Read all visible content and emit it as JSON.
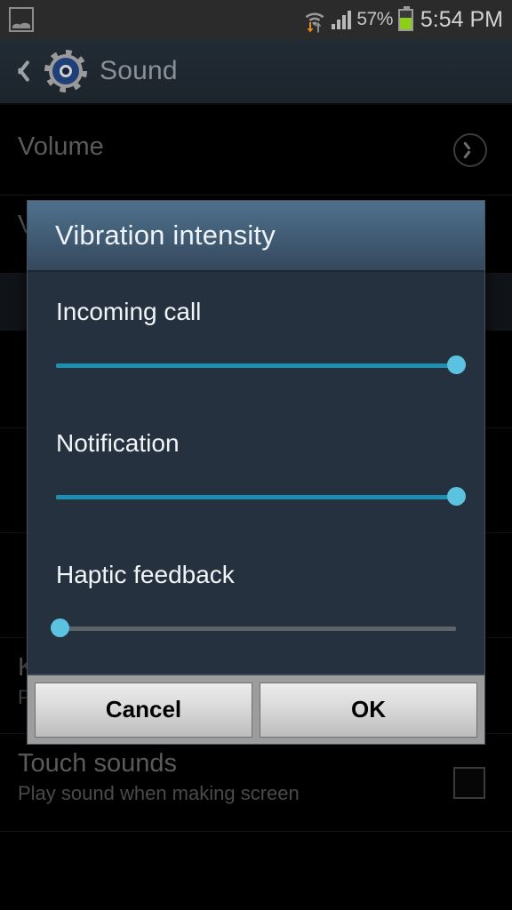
{
  "status_bar": {
    "notification_icon": "image-icon",
    "wifi_icon": "wifi-icon",
    "data_transfer_icon": "data-transfer-arrows-icon",
    "signal_icon": "cellular-signal-icon",
    "battery_percent": "57%",
    "battery_icon": "battery-icon",
    "battery_level_pct": 57,
    "time": "5:54 PM"
  },
  "action_bar": {
    "back_icon": "back-chevron-icon",
    "app_icon": "settings-gear-icon",
    "title": "Sound"
  },
  "background_list": {
    "rows": [
      {
        "title": "Volume",
        "subtitle": "",
        "accessory": "chevron-right-circle-icon"
      },
      {
        "title": "Vibration intensity",
        "subtitle": "",
        "accessory": "none"
      },
      {
        "title": "",
        "subtitle": "",
        "accessory": "none"
      },
      {
        "title": "",
        "subtitle": "",
        "accessory": "none"
      },
      {
        "title": "",
        "subtitle": "",
        "accessory": "none"
      },
      {
        "title": "",
        "subtitle": "",
        "accessory": "none"
      },
      {
        "title": "Keytones",
        "subtitle": "Play tones when keypad is pressed",
        "accessory": "checkbox-unchecked"
      },
      {
        "title": "Touch sounds",
        "subtitle": "Play sound when making screen",
        "accessory": "checkbox-unchecked"
      }
    ]
  },
  "dialog": {
    "title": "Vibration intensity",
    "sliders": [
      {
        "label": "Incoming call",
        "value_pct": 100
      },
      {
        "label": "Notification",
        "value_pct": 100
      },
      {
        "label": "Haptic feedback",
        "value_pct": 0
      }
    ],
    "cancel_label": "Cancel",
    "ok_label": "OK"
  },
  "colors": {
    "dialog_body": "#25313f",
    "dialog_header_top": "#4e708c",
    "dialog_header_bottom": "#35485c",
    "slider_fill": "#1d8fb0",
    "slider_thumb": "#5bc3df",
    "slider_track": "#5d6469",
    "battery_green": "#8bcf18",
    "accent_blue": "#1f3f78"
  }
}
